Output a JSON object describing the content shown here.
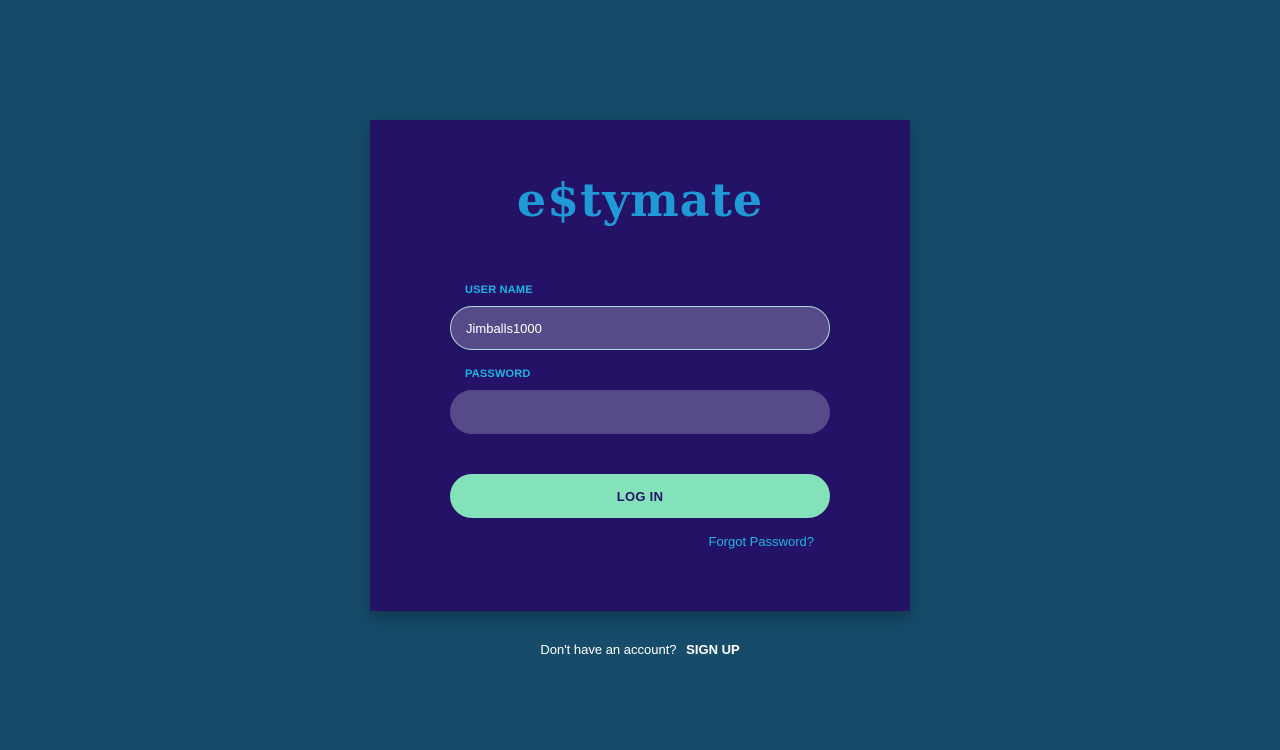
{
  "brand": {
    "logo_text": "e$tymate"
  },
  "login_form": {
    "username_label": "USER NAME",
    "username_value": "Jimballs1000",
    "password_label": "PASSWORD",
    "password_value": "",
    "login_button": "LOG IN",
    "forgot_password": "Forgot Password?"
  },
  "signup": {
    "prompt": "Don't have an account?",
    "link": "SIGN UP"
  },
  "colors": {
    "background": "#164b69",
    "card": "#241266",
    "accent": "#1f9ad6",
    "input_fill": "#564a88",
    "button": "#84e2bb"
  }
}
